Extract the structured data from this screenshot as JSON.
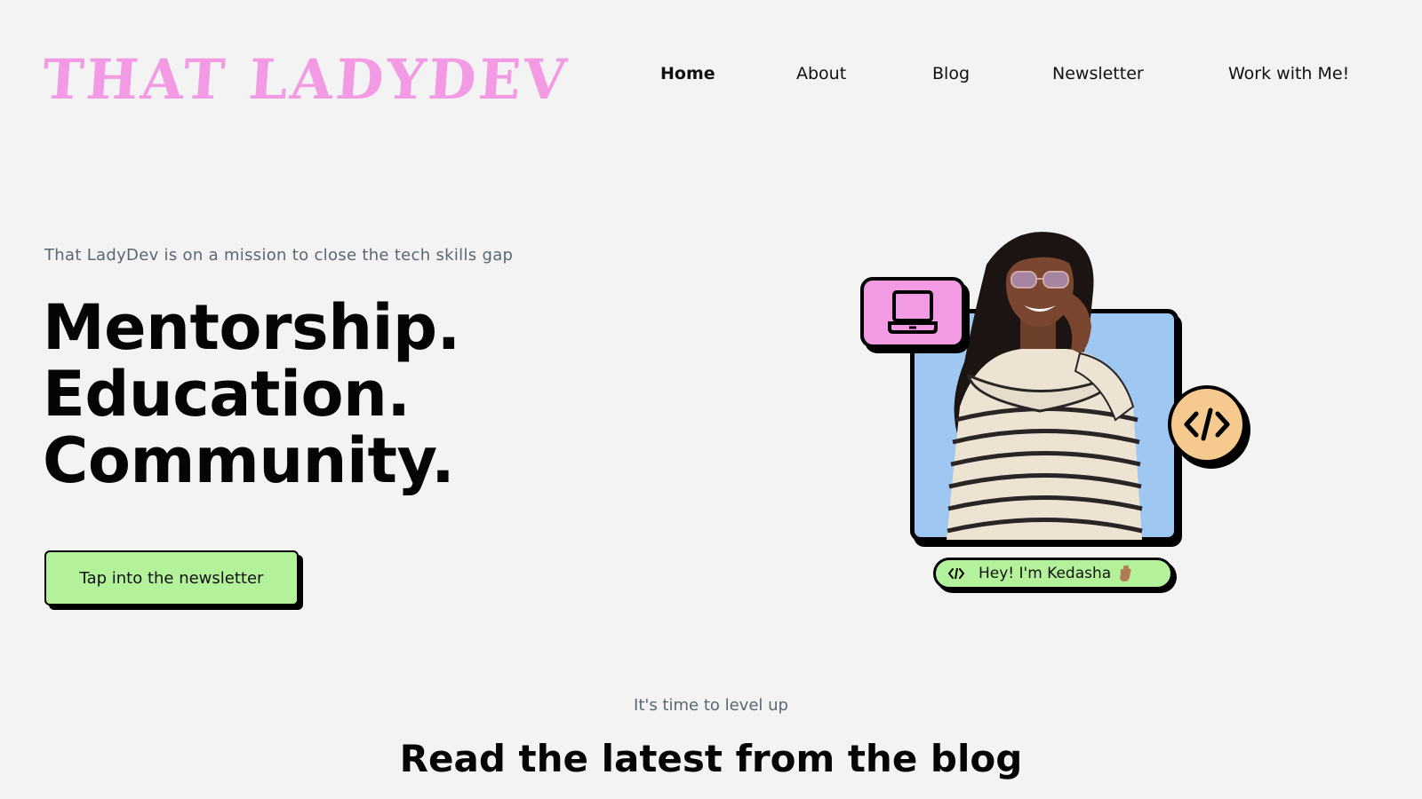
{
  "header": {
    "logo_text": "THAT LADYDEV",
    "nav": [
      {
        "label": "Home",
        "active": true
      },
      {
        "label": "About",
        "active": false
      },
      {
        "label": "Blog",
        "active": false
      },
      {
        "label": "Newsletter",
        "active": false
      },
      {
        "label": "Work with Me!",
        "active": false
      }
    ]
  },
  "hero": {
    "tagline": "That LadyDev is on a mission to close the tech skills gap",
    "headline": [
      "Mentorship.",
      "Education.",
      "Community."
    ],
    "cta_label": "Tap into the newsletter",
    "greeting": "Hey! I'm Kedasha",
    "icons": [
      "laptop-icon",
      "code-icon",
      "waving-hand-icon"
    ]
  },
  "blog_section": {
    "eyebrow": "It's time to level up",
    "title": "Read the latest from the blog"
  },
  "colors": {
    "background": "#f3f3f3",
    "brand_pink": "#f29ae4",
    "accent_green": "#b3f29a",
    "photo_blue": "#9ec7f2",
    "badge_orange": "#f6c98e",
    "muted_text": "#5b6674"
  }
}
